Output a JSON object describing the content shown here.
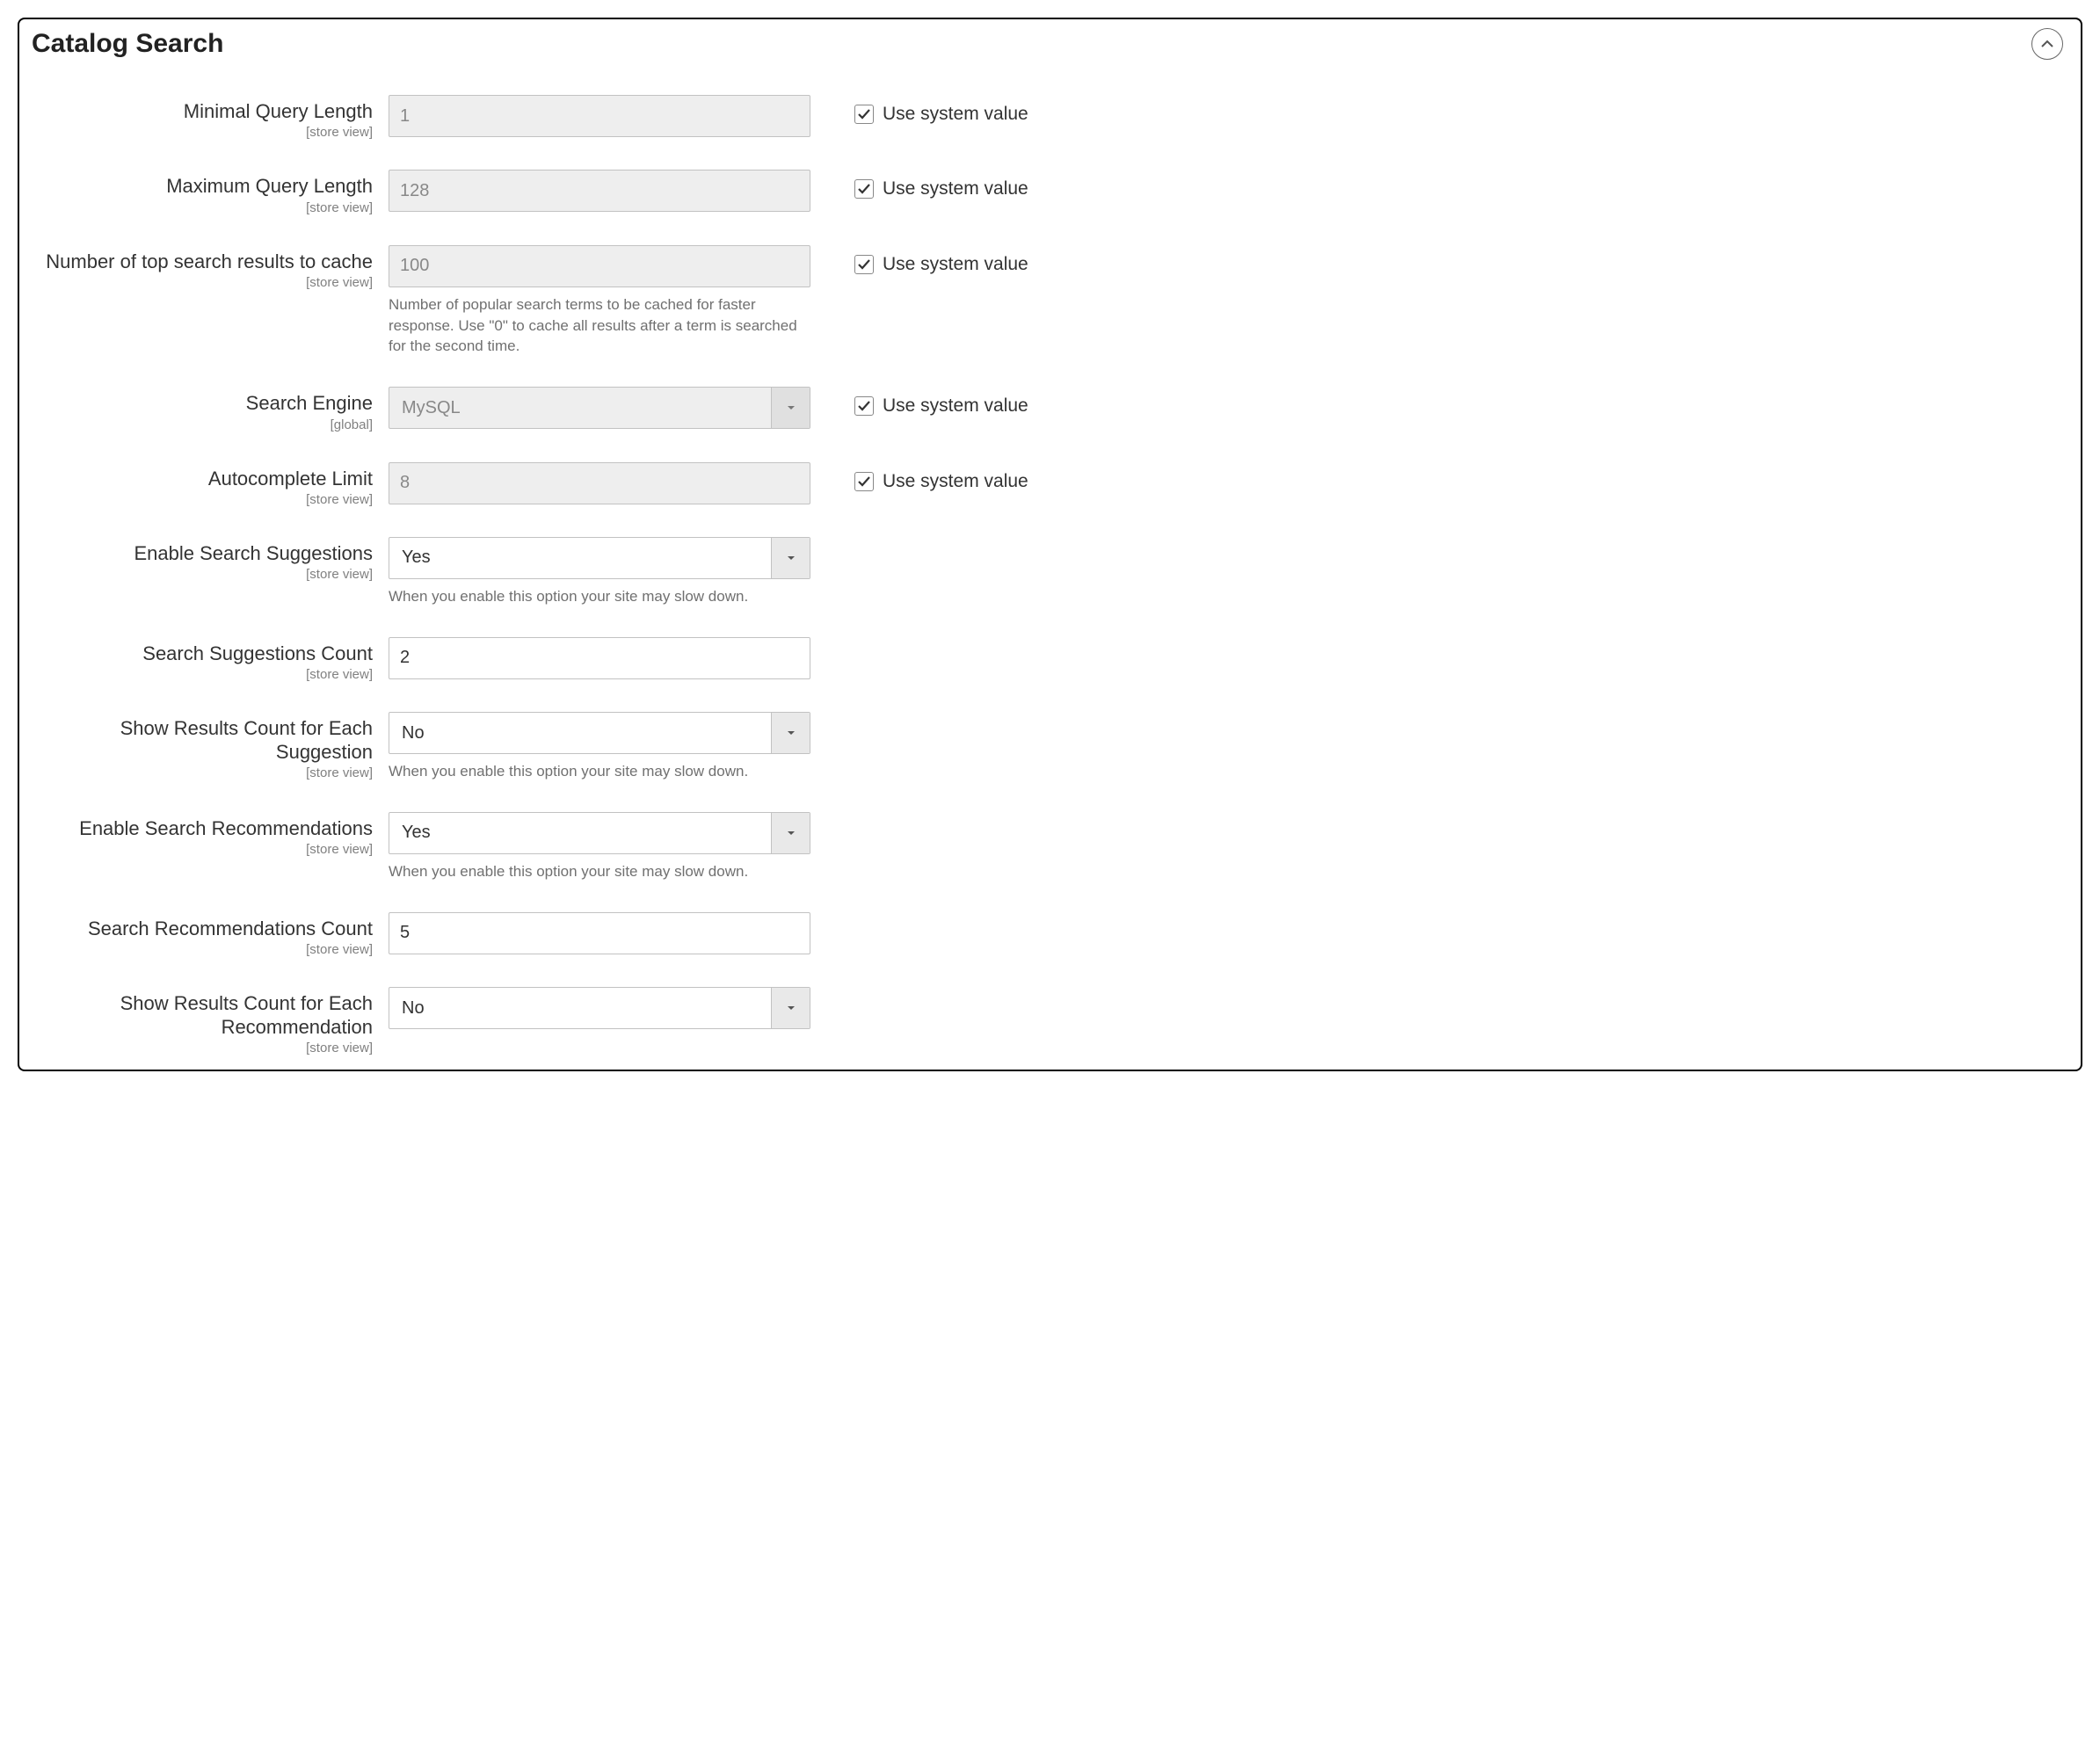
{
  "section": {
    "title": "Catalog Search"
  },
  "scope": {
    "store_view": "[store view]",
    "global": "[global]"
  },
  "common": {
    "use_system_value": "Use system value"
  },
  "fields": {
    "min_query_length": {
      "label": "Minimal Query Length",
      "value": "1",
      "scope": "store_view",
      "disabled": true,
      "use_system": true
    },
    "max_query_length": {
      "label": "Maximum Query Length",
      "value": "128",
      "scope": "store_view",
      "disabled": true,
      "use_system": true
    },
    "top_results_cache": {
      "label": "Number of top search results to cache",
      "value": "100",
      "scope": "store_view",
      "disabled": true,
      "use_system": true,
      "helper": "Number of popular search terms to be cached for faster response. Use \"0\" to cache all results after a term is searched for the second time."
    },
    "search_engine": {
      "label": "Search Engine",
      "value": "MySQL",
      "scope": "global",
      "disabled": true,
      "use_system": true
    },
    "autocomplete_limit": {
      "label": "Autocomplete Limit",
      "value": "8",
      "scope": "store_view",
      "disabled": true,
      "use_system": true
    },
    "enable_suggestions": {
      "label": "Enable Search Suggestions",
      "value": "Yes",
      "scope": "store_view",
      "helper": "When you enable this option your site may slow down."
    },
    "suggestions_count": {
      "label": "Search Suggestions Count",
      "value": "2",
      "scope": "store_view"
    },
    "show_results_per_suggestion": {
      "label": "Show Results Count for Each Suggestion",
      "value": "No",
      "scope": "store_view",
      "helper": "When you enable this option your site may slow down."
    },
    "enable_recommendations": {
      "label": "Enable Search Recommendations",
      "value": "Yes",
      "scope": "store_view",
      "helper": "When you enable this option your site may slow down."
    },
    "recommendations_count": {
      "label": "Search Recommendations Count",
      "value": "5",
      "scope": "store_view"
    },
    "show_results_per_recommendation": {
      "label": "Show Results Count for Each Recommendation",
      "value": "No",
      "scope": "store_view"
    }
  }
}
